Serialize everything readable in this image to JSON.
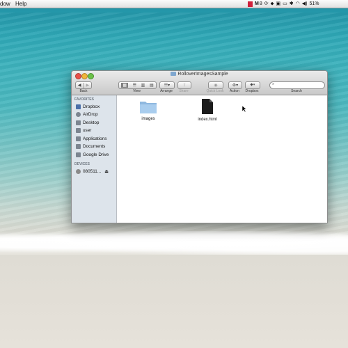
{
  "menubar": {
    "menus": [
      "dow",
      "Help"
    ],
    "status_items": [
      "M",
      "8",
      "51%"
    ]
  },
  "window": {
    "title": "RolloverImagesSample",
    "toolbar": {
      "back_label": "Back",
      "view_label": "View",
      "arrange_label": "Arrange",
      "share_label": "Share",
      "quicklook_label": "Quick Look",
      "action_label": "Action",
      "dropbox_label": "Dropbox",
      "search_label": "Search"
    },
    "sidebar": {
      "favorites_header": "FAVORITES",
      "favorites": [
        {
          "label": "Dropbox",
          "icon": "dropbox-icon"
        },
        {
          "label": "AirDrop",
          "icon": "airdrop-icon"
        },
        {
          "label": "Desktop",
          "icon": "desktop-icon"
        },
        {
          "label": "user",
          "icon": "home-icon"
        },
        {
          "label": "Applications",
          "icon": "applications-icon"
        },
        {
          "label": "Documents",
          "icon": "documents-icon"
        },
        {
          "label": "Google Drive",
          "icon": "google-drive-icon"
        }
      ],
      "devices_header": "DEVICES",
      "devices": [
        {
          "label": "080511...",
          "icon": "disk-icon"
        }
      ]
    },
    "files": [
      {
        "name": "images",
        "type": "folder"
      },
      {
        "name": "index.html",
        "type": "html-file"
      }
    ]
  },
  "colors": {
    "folder": "#9cc3e6",
    "sidebar_bg": "#dde4eb",
    "red_button": "#e8504a",
    "yellow_button": "#f0b53a",
    "green_button": "#6cc24a"
  }
}
